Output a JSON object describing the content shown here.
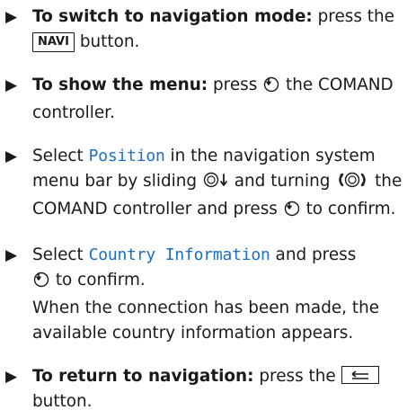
{
  "steps": [
    {
      "bold": "To switch to navigation mode:",
      "text_a": " press the ",
      "key": "NAVI",
      "text_b": " button."
    },
    {
      "bold": "To show the menu:",
      "text_a": " press ",
      "text_b": " the COMAND controller."
    },
    {
      "text_a": "Select ",
      "highlight": "Position",
      "text_b": " in the navigation system menu bar by sliding ",
      "text_c": " and turning ",
      "text_d": " the COMAND controller and press ",
      "text_e": " to confirm."
    },
    {
      "text_a": "Select ",
      "highlight": "Country Information",
      "text_b": " and press ",
      "text_c": " to confirm.",
      "result": "When the connection has been made, the available country information appears."
    },
    {
      "bold": "To return to navigation:",
      "text_a": " press the ",
      "text_b": " button."
    }
  ],
  "icons": {
    "bullet": "triangle-right-icon",
    "press": "press-controller-icon",
    "slide_down": "slide-down-controller-icon",
    "turn": "turn-controller-icon",
    "back_key": "back-key-icon"
  },
  "colors": {
    "highlight": "#1c6fc0",
    "text": "#1a1a1a"
  }
}
